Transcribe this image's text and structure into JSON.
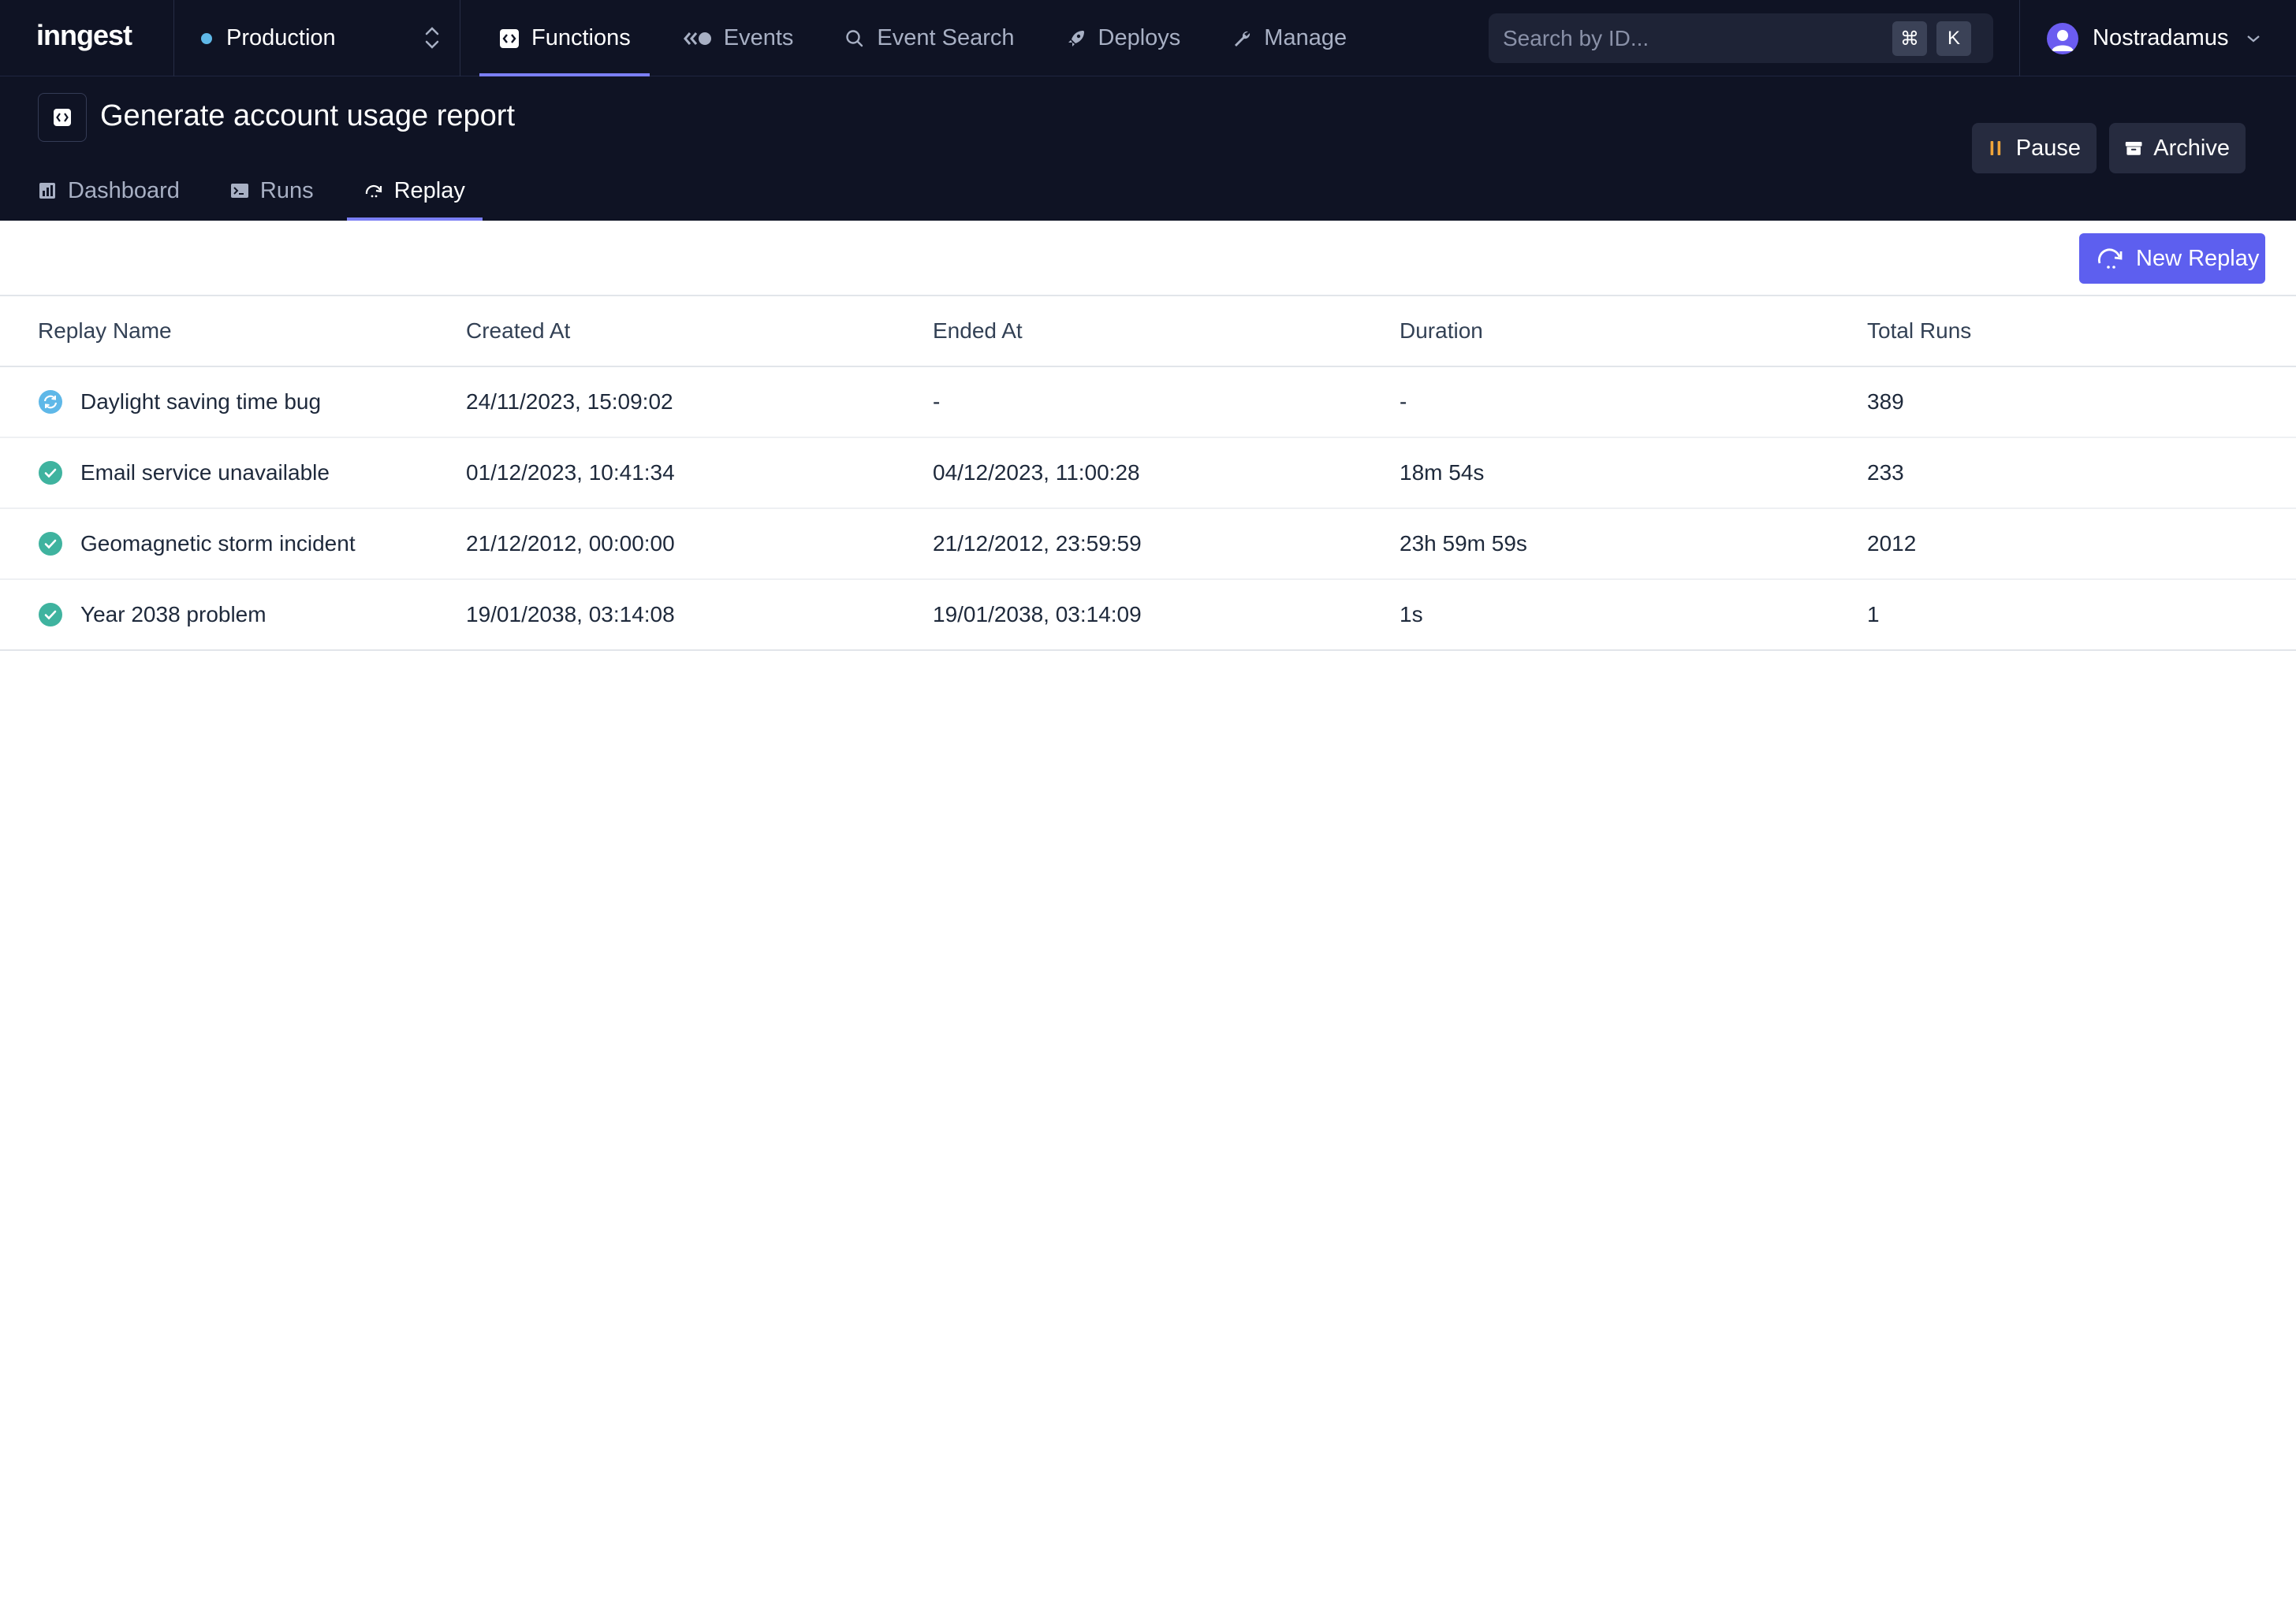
{
  "app": {
    "logo": "inngest",
    "environment": "Production",
    "nav": [
      {
        "label": "Functions",
        "icon": "code-square-icon",
        "active": true
      },
      {
        "label": "Events",
        "icon": "events-icon",
        "active": false
      },
      {
        "label": "Event Search",
        "icon": "search-icon",
        "active": false
      },
      {
        "label": "Deploys",
        "icon": "rocket-icon",
        "active": false
      },
      {
        "label": "Manage",
        "icon": "wrench-icon",
        "active": false
      }
    ],
    "search": {
      "placeholder": "Search by ID...",
      "shortcut_cmd": "⌘",
      "shortcut_key": "K"
    },
    "user": {
      "name": "Nostradamus"
    }
  },
  "function": {
    "title": "Generate account usage report",
    "tabs": [
      {
        "label": "Dashboard",
        "icon": "chart-icon",
        "active": false
      },
      {
        "label": "Runs",
        "icon": "terminal-icon",
        "active": false
      },
      {
        "label": "Replay",
        "icon": "replay-icon",
        "active": true
      }
    ],
    "actions": {
      "pause": "Pause",
      "archive": "Archive"
    }
  },
  "toolbar": {
    "new_replay": "New Replay"
  },
  "table": {
    "headers": [
      "Replay Name",
      "Created At",
      "Ended At",
      "Duration",
      "Total Runs"
    ],
    "rows": [
      {
        "status": "running",
        "name": "Daylight saving time bug",
        "created": "24/11/2023, 15:09:02",
        "ended": "-",
        "duration": "-",
        "runs": "389"
      },
      {
        "status": "completed",
        "name": "Email service unavailable",
        "created": "01/12/2023, 10:41:34",
        "ended": "04/12/2023, 11:00:28",
        "duration": "18m 54s",
        "runs": "233"
      },
      {
        "status": "completed",
        "name": "Geomagnetic storm incident",
        "created": "21/12/2012, 00:00:00",
        "ended": "21/12/2012, 23:59:59",
        "duration": "23h 59m 59s",
        "runs": "2012"
      },
      {
        "status": "completed",
        "name": "Year 2038 problem",
        "created": "19/01/2038, 03:14:08",
        "ended": "19/01/2038, 03:14:09",
        "duration": "1s",
        "runs": "1"
      }
    ]
  },
  "colors": {
    "accent": "#5d5fef",
    "nav_bg": "#0f1324",
    "running": "#5fb8e8",
    "completed": "#3fb39f",
    "pause_icon": "#f0a53a"
  }
}
